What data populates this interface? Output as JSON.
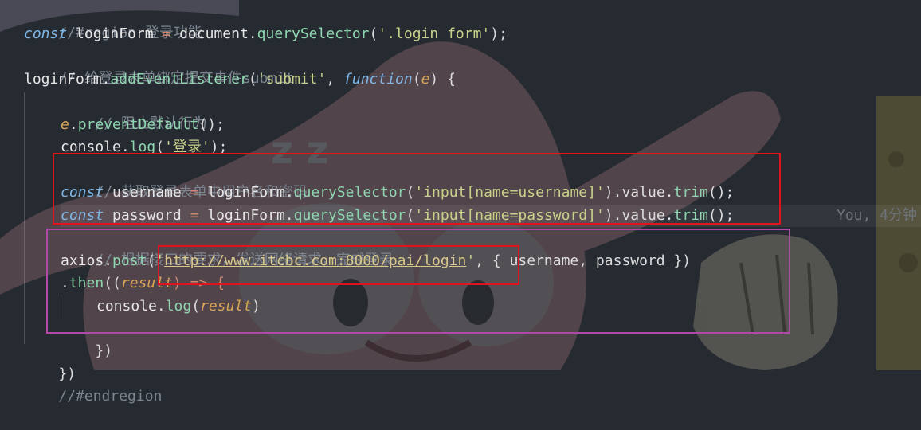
{
  "code": {
    "l0_comment": "//#region 登录功能",
    "l1_const": "const",
    "l1_var": "loginForm",
    "l1_eq": " = ",
    "l1_doc": "document",
    "l1_dot": ".",
    "l1_fn": "querySelector",
    "l1_open": "(",
    "l1_str": "'.login form'",
    "l1_close": ");",
    "l2_comment": "// 给登录表单绑定提交事件submit",
    "l3_obj": "loginForm",
    "l3_dot": ".",
    "l3_fn": "addEventListener",
    "l3_open": "(",
    "l3_str": "'submit'",
    "l3_comma": ", ",
    "l3_function": "function",
    "l3_p1": "(",
    "l3_param": "e",
    "l3_p2": ") {",
    "l4_comment": "// 阻止默认行为",
    "l5_obj": "e",
    "l5_dot": ".",
    "l5_fn": "preventDefault",
    "l5_end": "();",
    "l6_obj": "console",
    "l6_dot": ".",
    "l6_fn": "log",
    "l6_open": "(",
    "l6_str": "'登录'",
    "l6_close": ");",
    "l7_comment": "// 获取登录表单中用户名和密码",
    "l8_const": "const",
    "l8_var": "username",
    "l8_eq": " = ",
    "l8_obj": "loginForm",
    "l8_dot": ".",
    "l8_fn": "querySelector",
    "l8_open": "(",
    "l8_str": "'input[name=username]'",
    "l8_mid": ").value.",
    "l8_fn2": "trim",
    "l8_end": "();",
    "l9_const": "const",
    "l9_var": "password",
    "l9_eq": " = ",
    "l9_obj": "loginForm",
    "l9_dot": ".",
    "l9_fn": "querySelector",
    "l9_open": "(",
    "l9_str": "'input[name=password]'",
    "l9_mid": ").value.",
    "l9_fn2": "trim",
    "l9_end": "();",
    "l10_comment": "// 根据接口的要求，发送网络请求，完成登录",
    "l11_obj": "axios",
    "l11_dot": ".",
    "l11_fn": "post",
    "l11_open": "(",
    "l11_q1": "'",
    "l11_url": "http://www.itcbc.com:8000/pai/login",
    "l11_q2": "'",
    "l11_rest": ", { username, password })",
    "l12_dot": ".",
    "l12_fn": "then",
    "l12_p1": "((",
    "l12_param": "result",
    "l12_arrow": ") => {",
    "l13_obj": "console",
    "l13_dot": ".",
    "l13_fn": "log",
    "l13_open": "(",
    "l13_param": "result",
    "l13_close": ")",
    "l14_close": "})",
    "l15_close": "})",
    "l16_comment": "//#endregion"
  },
  "blame": "You, 4分钟"
}
